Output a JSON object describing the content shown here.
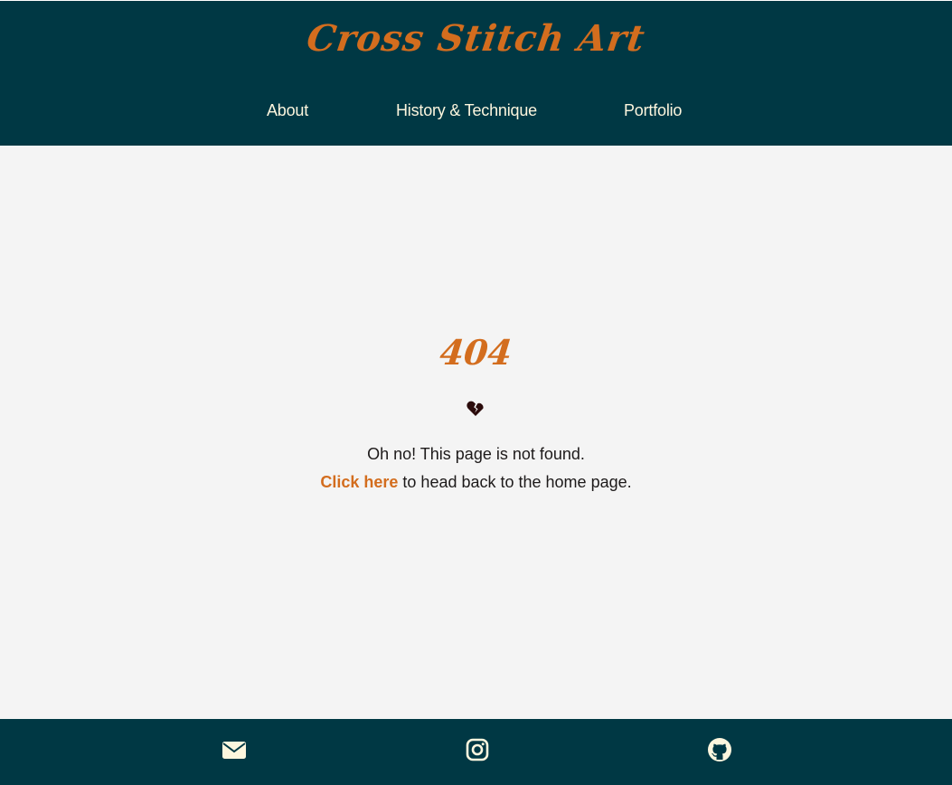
{
  "header": {
    "site_title": "Cross Stitch Art",
    "nav": [
      {
        "label": "About"
      },
      {
        "label": "History & Technique"
      },
      {
        "label": "Portfolio"
      }
    ]
  },
  "main": {
    "error_code": "404",
    "icon": "broken-heart-icon",
    "message_line1": "Oh no! This page is not found.",
    "link_label": "Click here",
    "message_line2_rest": " to head back to the home page."
  },
  "footer": {
    "icons": [
      "envelope-icon",
      "instagram-icon",
      "github-icon"
    ]
  },
  "colors": {
    "header_bg": "#003844",
    "accent": "#d36d1e",
    "nav_text": "#fdf6de",
    "page_bg": "#f4f4f4",
    "body_text": "#1d1a1a",
    "heart": "#2b0b0b"
  }
}
